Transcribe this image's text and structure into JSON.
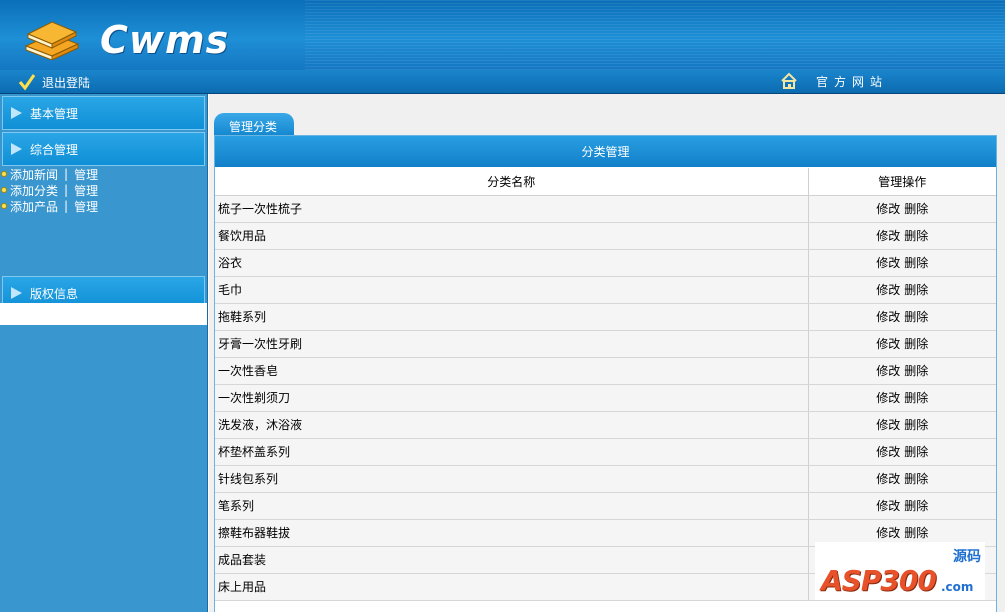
{
  "header": {
    "logo_text": "Cwms"
  },
  "topbar": {
    "logout_label": "退出登陆",
    "homepage_label": "官方网站"
  },
  "sidebar": {
    "sections": [
      {
        "label": "基本管理"
      },
      {
        "label": "综合管理"
      },
      {
        "label": "版权信息"
      }
    ],
    "sub_items": [
      {
        "add": "添加新闻",
        "sep": "|",
        "manage": "管理"
      },
      {
        "add": "添加分类",
        "sep": "|",
        "manage": "管理"
      },
      {
        "add": "添加产品",
        "sep": "|",
        "manage": "管理"
      }
    ]
  },
  "main": {
    "tab_label": "管理分类",
    "panel_title": "分类管理",
    "columns": [
      "分类名称",
      "管理操作"
    ],
    "rows": [
      {
        "name": "梳子一次性梳子",
        "edit": "修改",
        "del": "删除"
      },
      {
        "name": "餐饮用品",
        "edit": "修改",
        "del": "删除"
      },
      {
        "name": "浴衣",
        "edit": "修改",
        "del": "删除"
      },
      {
        "name": "毛巾",
        "edit": "修改",
        "del": "删除"
      },
      {
        "name": "拖鞋系列",
        "edit": "修改",
        "del": "删除"
      },
      {
        "name": "牙膏一次性牙刷",
        "edit": "修改",
        "del": "删除"
      },
      {
        "name": "一次性香皂",
        "edit": "修改",
        "del": "删除"
      },
      {
        "name": "一次性剃须刀",
        "edit": "修改",
        "del": "删除"
      },
      {
        "name": "洗发液，沐浴液",
        "edit": "修改",
        "del": "删除"
      },
      {
        "name": "杯垫杯盖系列",
        "edit": "修改",
        "del": "删除"
      },
      {
        "name": "针线包系列",
        "edit": "修改",
        "del": "删除"
      },
      {
        "name": "笔系列",
        "edit": "修改",
        "del": "删除"
      },
      {
        "name": "擦鞋布器鞋拔",
        "edit": "修改",
        "del": "删除"
      },
      {
        "name": "成品套装",
        "edit": "",
        "del": ""
      },
      {
        "name": "床上用品",
        "edit": "",
        "del": ""
      }
    ]
  },
  "watermark": {
    "brand": "ASP300",
    "sub": "源码",
    "domain": ".com"
  },
  "icons": {
    "logo": "book-stack-icon",
    "logout": "checkmark-icon",
    "home": "house-icon",
    "section_arrow": "arrow-right-icon",
    "sub_bullet": "bullet-icon"
  },
  "colors": {
    "header_blue": "#1e8fd6",
    "sidebar_blue": "#3a96cf",
    "panel_title_blue": "#1180c9",
    "bullet_yellow": "#ffe14a"
  }
}
